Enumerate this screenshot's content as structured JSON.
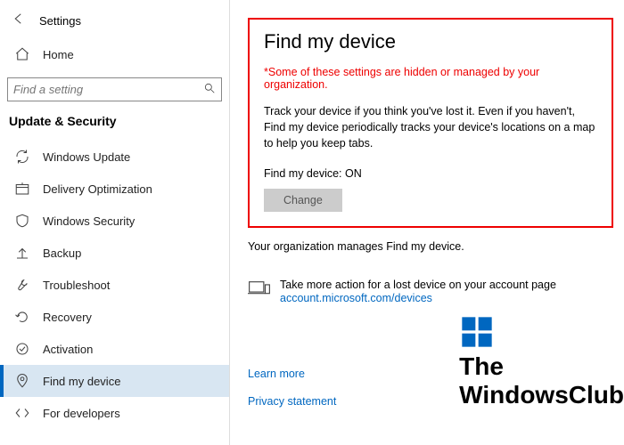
{
  "appTitle": "Settings",
  "search": {
    "placeholder": "Find a setting"
  },
  "category": "Update & Security",
  "nav": {
    "home": "Home",
    "items": [
      "Windows Update",
      "Delivery Optimization",
      "Windows Security",
      "Backup",
      "Troubleshoot",
      "Recovery",
      "Activation",
      "Find my device",
      "For developers"
    ]
  },
  "page": {
    "title": "Find my device",
    "warning": "*Some of these settings are hidden or managed by your organization.",
    "description": "Track your device if you think you've lost it. Even if you haven't, Find my device periodically tracks your device's locations on a map to help you keep tabs.",
    "status": "Find my device: ON",
    "changeBtn": "Change",
    "orgManages": "Your organization manages Find my device.",
    "actionText": "Take more action for a lost device on your account page",
    "actionLink": "account.microsoft.com/devices",
    "learnMore": "Learn more",
    "privacy": "Privacy statement"
  },
  "watermark": {
    "line1": "The",
    "line2": "WindowsClub"
  }
}
